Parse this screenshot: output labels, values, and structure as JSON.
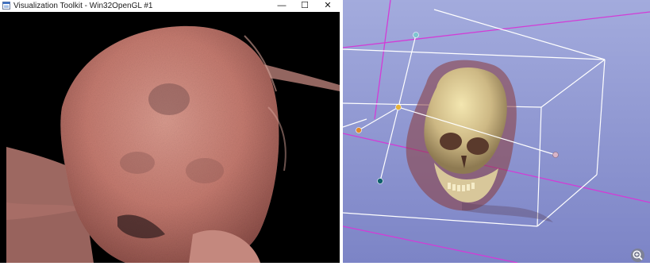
{
  "window": {
    "title": "Visualization Toolkit - Win32OpenGL #1",
    "icon": "app-icon",
    "controls": {
      "minimize": "—",
      "maximize": "☐",
      "close": "✕"
    }
  },
  "left_view": {
    "content": "volume-rendered head (raw volume)",
    "background": "#000000",
    "tissue_color": "#c97f74"
  },
  "right_view": {
    "background_top": "#9ea6da",
    "background_bottom": "#7d86c8",
    "bounding_box_color": "#ffffff",
    "slice_plane_color": "#d23cd6",
    "handle_colors": [
      "#7fc6d0",
      "#e6b23a",
      "#e08a2a",
      "#0e5f6b",
      "#d8b4c8"
    ],
    "zoom_icon": "zoom-in-icon"
  }
}
